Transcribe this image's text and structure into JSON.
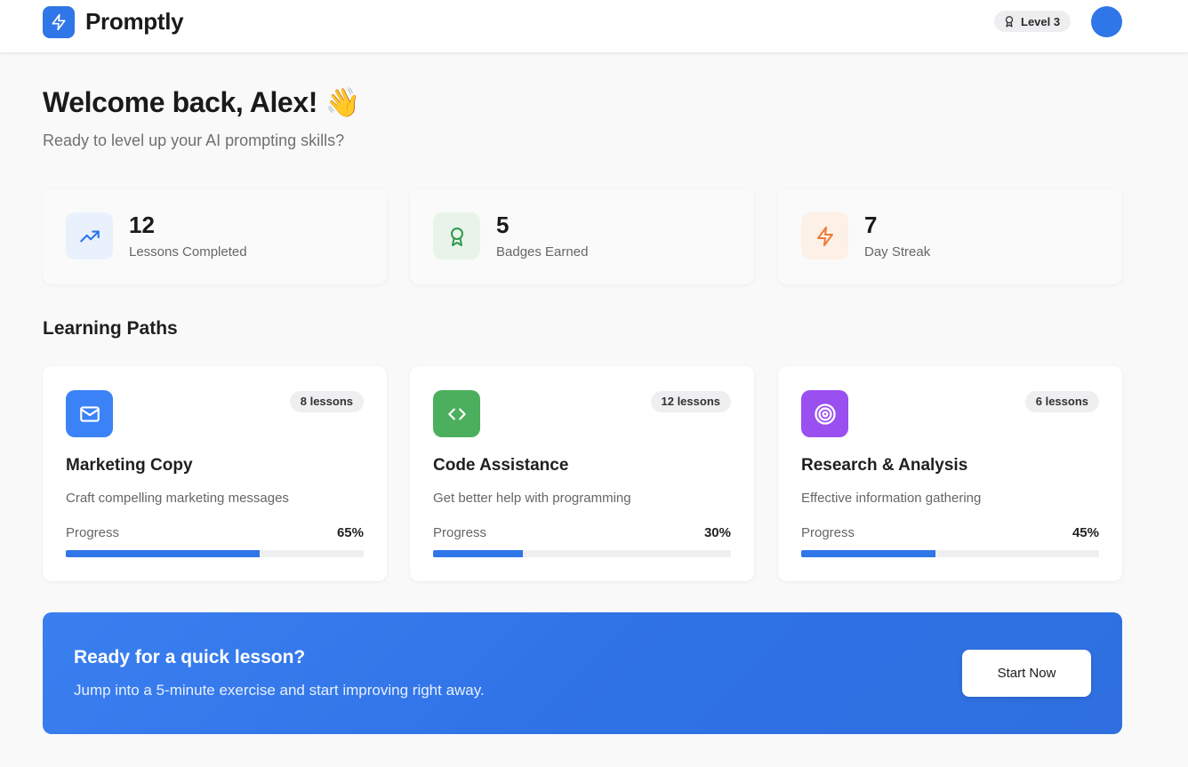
{
  "header": {
    "brand": "Promptly",
    "level_label": "Level 3",
    "accent": "#2f76e8"
  },
  "welcome": {
    "title": "Welcome back, Alex! 👋",
    "subtitle": "Ready to level up your AI prompting skills?"
  },
  "stats": [
    {
      "value": "12",
      "label": "Lessons Completed",
      "icon": "trending-up-icon",
      "color": "#2f76e8"
    },
    {
      "value": "5",
      "label": "Badges Earned",
      "icon": "award-icon",
      "color": "#2e9a4a"
    },
    {
      "value": "7",
      "label": "Day Streak",
      "icon": "zap-icon",
      "color": "#ef7a35"
    }
  ],
  "learning_paths": {
    "title": "Learning Paths",
    "progress_label": "Progress",
    "items": [
      {
        "title": "Marketing Copy",
        "description": "Craft compelling marketing messages",
        "lessons": "8 lessons",
        "progress": 65,
        "progress_text": "65%",
        "icon": "mail-icon",
        "color": "#3b82f6"
      },
      {
        "title": "Code Assistance",
        "description": "Get better help with programming",
        "lessons": "12 lessons",
        "progress": 30,
        "progress_text": "30%",
        "icon": "code-icon",
        "color": "#4caf5d"
      },
      {
        "title": "Research & Analysis",
        "description": "Effective information gathering",
        "lessons": "6 lessons",
        "progress": 45,
        "progress_text": "45%",
        "icon": "target-icon",
        "color": "#9a4ff0"
      }
    ]
  },
  "cta": {
    "title": "Ready for a quick lesson?",
    "description": "Jump into a 5-minute exercise and start improving right away.",
    "button": "Start Now"
  }
}
